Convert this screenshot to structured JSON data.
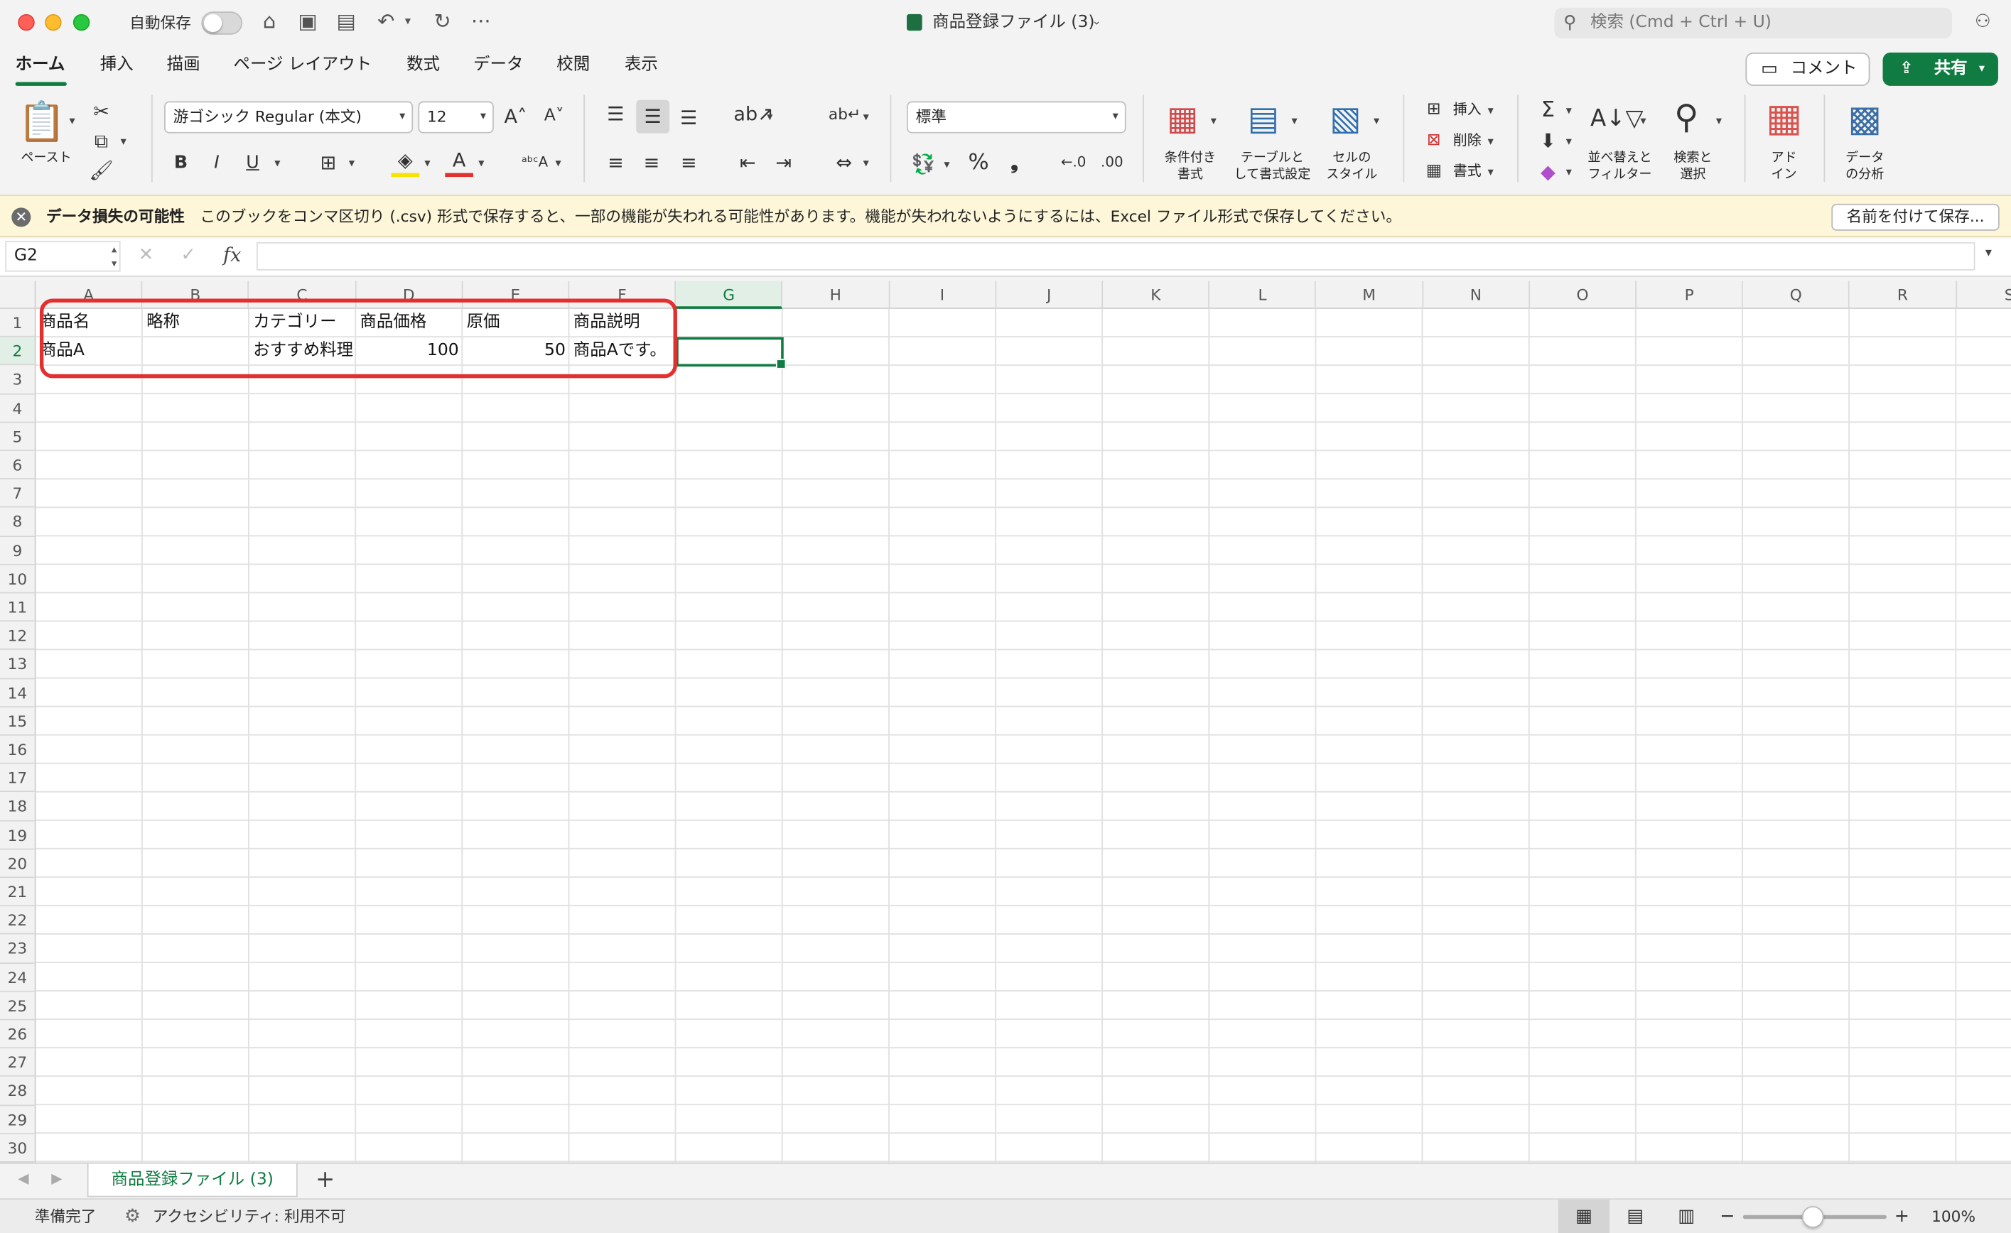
{
  "titlebar": {
    "autosave_label": "自動保存",
    "doc_title": "商品登録ファイル (3)",
    "search_placeholder": "検索 (Cmd + Ctrl + U)"
  },
  "menu": {
    "tabs": [
      "ホーム",
      "挿入",
      "描画",
      "ページ レイアウト",
      "数式",
      "データ",
      "校閲",
      "表示"
    ],
    "active_tab": "ホーム",
    "comment_label": "コメント",
    "share_label": "共有"
  },
  "ribbon": {
    "paste_label": "ペースト",
    "font_name": "游ゴシック Regular (本文)",
    "font_size": "12",
    "number_format": "標準",
    "conditional_format_label": [
      "条件付き",
      "書式"
    ],
    "format_as_table_label": [
      "テーブルと",
      "して書式設定"
    ],
    "cell_styles_label": [
      "セルの",
      "スタイル"
    ],
    "insert_label": "挿入",
    "delete_label": "削除",
    "format_label": "書式",
    "sort_filter_label": [
      "並べ替えと",
      "フィルター"
    ],
    "find_select_label": [
      "検索と",
      "選択"
    ],
    "addins_label": [
      "アド",
      "イン"
    ],
    "analyze_data_label": [
      "データ",
      "の分析"
    ]
  },
  "infobar": {
    "title": "データ損失の可能性",
    "message": "このブックをコンマ区切り (.csv) 形式で保存すると、一部の機能が失われる可能性があります。機能が失われないようにするには、Excel ファイル形式で保存してください。",
    "save_as_button": "名前を付けて保存..."
  },
  "formula_bar": {
    "name_box": "G2",
    "fx_label": "fx",
    "formula": ""
  },
  "sheet": {
    "columns": [
      "A",
      "B",
      "C",
      "D",
      "E",
      "F",
      "G",
      "H",
      "I",
      "J",
      "K",
      "L",
      "M",
      "N",
      "O",
      "P",
      "Q",
      "R",
      "S"
    ],
    "selected_column": "G",
    "selected_row": "2",
    "rows": [
      "1",
      "2",
      "3",
      "4",
      "5",
      "6",
      "7",
      "8",
      "9",
      "10",
      "11",
      "12",
      "13",
      "14",
      "15",
      "16",
      "17",
      "18",
      "19",
      "20",
      "21",
      "22",
      "23",
      "24",
      "25",
      "26",
      "27",
      "28",
      "29",
      "30"
    ],
    "header_row": [
      "商品名",
      "略称",
      "カテゴリー",
      "商品価格",
      "原価",
      "商品説明"
    ],
    "data_row": [
      "商品A",
      "",
      "おすすめ料理",
      "100",
      "50",
      "商品Aです。"
    ]
  },
  "sheet_tabs": {
    "active": "商品登録ファイル (3)",
    "add_label": "+"
  },
  "status": {
    "ready": "準備完了",
    "accessibility": "アクセシビリティ: 利用不可",
    "zoom": "100%"
  },
  "colors": {
    "accent": "#107c41",
    "annotation_red": "#e1302e",
    "infobar_bg": "#fdf6d8"
  }
}
